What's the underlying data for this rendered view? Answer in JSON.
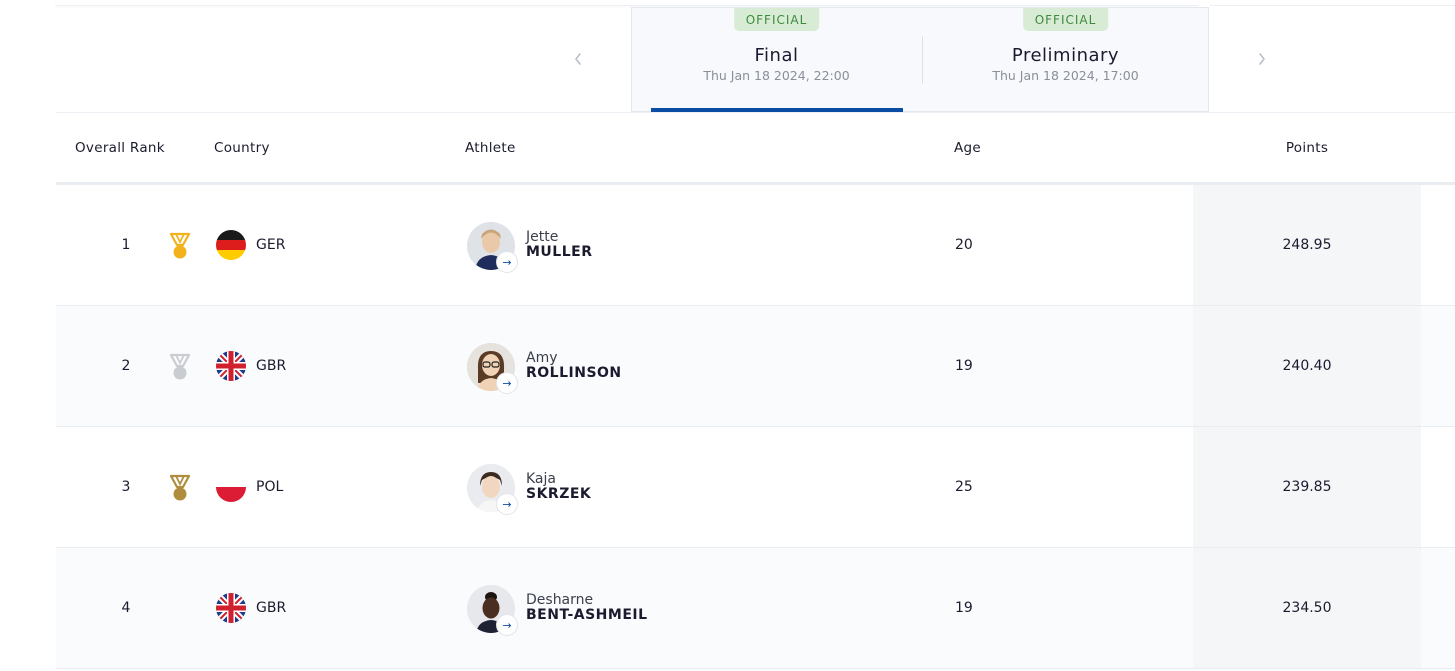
{
  "phases": {
    "tabs": [
      {
        "badge": "OFFICIAL",
        "title": "Final",
        "date": "Thu Jan 18 2024, 22:00",
        "active": true
      },
      {
        "badge": "OFFICIAL",
        "title": "Preliminary",
        "date": "Thu Jan 18 2024, 17:00",
        "active": false
      }
    ],
    "prev_icon": "chevron-left-icon",
    "next_icon": "chevron-right-icon"
  },
  "table": {
    "headers": {
      "rank": "Overall Rank",
      "country": "Country",
      "athlete": "Athlete",
      "age": "Age",
      "points": "Points"
    },
    "rows": [
      {
        "rank": "1",
        "medal": "gold",
        "country": "GER",
        "first_name": "Jette",
        "last_name": "MULLER",
        "age": "20",
        "points": "248.95"
      },
      {
        "rank": "2",
        "medal": "silver",
        "country": "GBR",
        "first_name": "Amy",
        "last_name": "ROLLINSON",
        "age": "19",
        "points": "240.40"
      },
      {
        "rank": "3",
        "medal": "bronze",
        "country": "POL",
        "first_name": "Kaja",
        "last_name": "SKRZEK",
        "age": "25",
        "points": "239.85"
      },
      {
        "rank": "4",
        "medal": "",
        "country": "GBR",
        "first_name": "Desharne",
        "last_name": "BENT-ASHMEIL",
        "age": "19",
        "points": "234.50"
      }
    ]
  },
  "colors": {
    "accent": "#0b4da2",
    "badge_bg": "#d8ecd5",
    "badge_text": "#3d8a3d",
    "gold": "#f2b21c",
    "silver": "#c9ccd1",
    "bronze": "#b08d3e"
  }
}
